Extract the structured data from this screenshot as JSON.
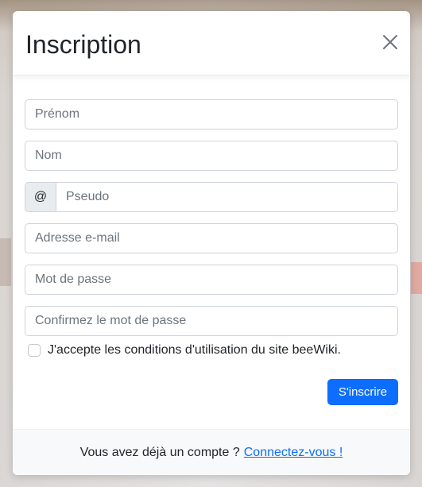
{
  "modal": {
    "title": "Inscription",
    "close_icon": "close-icon"
  },
  "form": {
    "first_name": {
      "value": "",
      "placeholder": "Prénom"
    },
    "last_name": {
      "value": "",
      "placeholder": "Nom"
    },
    "username": {
      "prefix": "@",
      "value": "",
      "placeholder": "Pseudo"
    },
    "email": {
      "value": "",
      "placeholder": "Adresse e-mail"
    },
    "password": {
      "value": "",
      "placeholder": "Mot de passe"
    },
    "confirm_password": {
      "value": "",
      "placeholder": "Confirmez le mot de passe"
    },
    "terms": {
      "label": "J'accepte les conditions d'utilisation du site beeWiki.",
      "checked": false
    },
    "submit_label": "S'inscrire"
  },
  "footer": {
    "text": "Vous avez déjà un compte ?",
    "link_label": "Connectez-vous !"
  },
  "colors": {
    "primary": "#0d6efd",
    "border": "#ced4da",
    "footer_bg": "#f8f9fa",
    "addon_bg": "#e9ecef"
  }
}
